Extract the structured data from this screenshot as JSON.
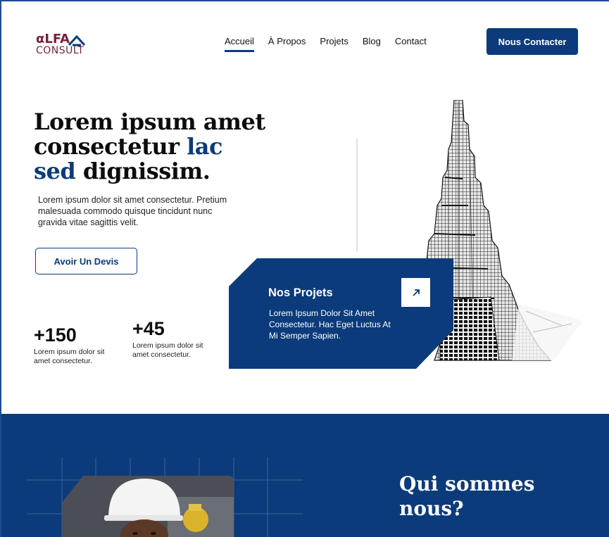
{
  "brand": {
    "logo_line1": "αLFA",
    "logo_line2": "CONSULT",
    "primary_color": "#0b3b7a",
    "logo_color": "#7a1f3d"
  },
  "nav": {
    "items": [
      {
        "label": "Accueil",
        "active": true
      },
      {
        "label": "À Propos",
        "active": false
      },
      {
        "label": "Projets",
        "active": false
      },
      {
        "label": "Blog",
        "active": false
      },
      {
        "label": "Contact",
        "active": false
      }
    ],
    "cta_label": "Nous Contacter"
  },
  "hero": {
    "title_part1": "Lorem ipsum  amet consectetur ",
    "title_accent": "lac sed",
    "title_part2": " dignissim.",
    "description": "Lorem ipsum dolor sit amet consectetur. Pretium malesuada commodo quisque tincidunt nunc gravida vitae sagittis velit.",
    "button_label": "Avoir Un Devis",
    "stats": [
      {
        "value": "+150",
        "text": "Lorem ipsum dolor sit amet consectetur."
      },
      {
        "value": "+45",
        "text": "Lorem ipsum dolor sit amet consectetur."
      }
    ]
  },
  "projects_card": {
    "title": "Nos Projets",
    "description": "Lorem Ipsum Dolor Sit Amet Consectetur. Hac Eget Luctus At Mi Semper Sapien.",
    "arrow_icon": "arrow-up-right-icon"
  },
  "about": {
    "title": "Qui sommes nous?"
  }
}
